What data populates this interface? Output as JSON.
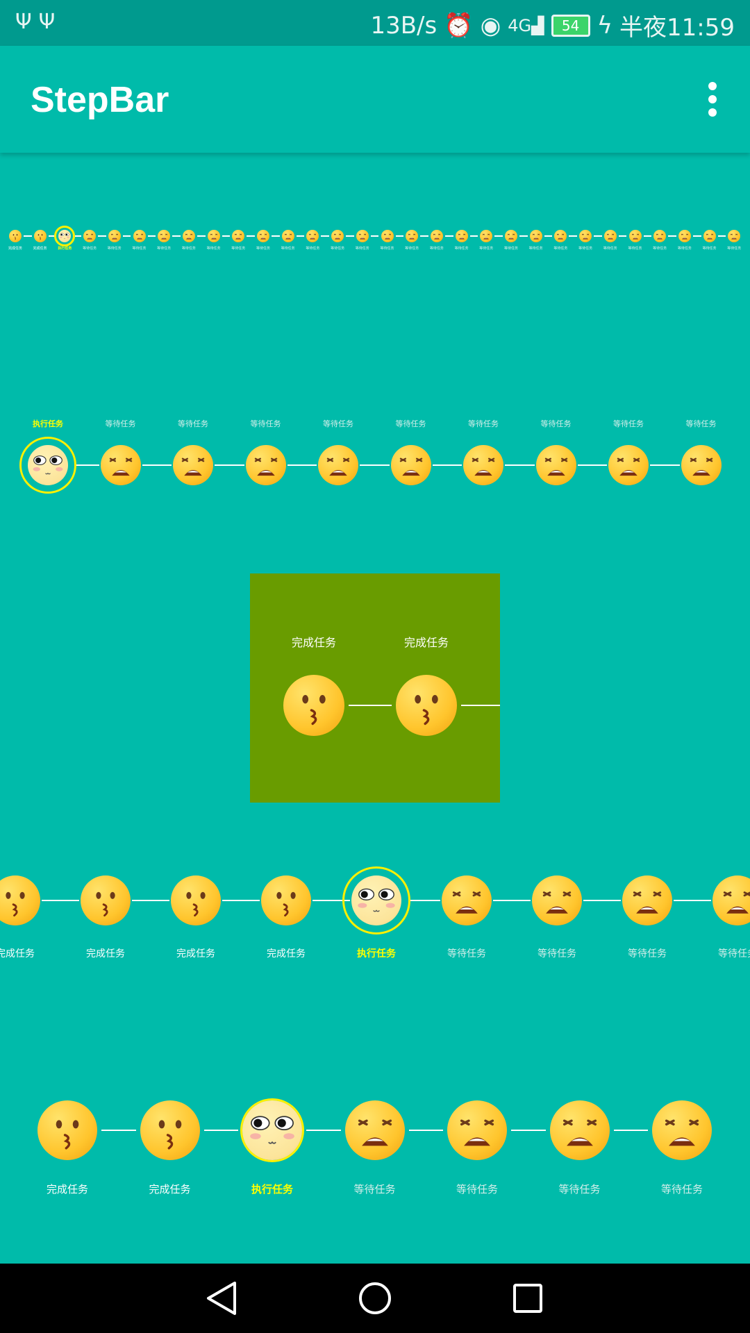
{
  "status_bar": {
    "left_icons": [
      "usb-icon",
      "usb-icon"
    ],
    "net_speed": "13B/s",
    "icons": [
      "alarm-icon",
      "eye-icon",
      "signal-4g-icon"
    ],
    "battery": "54",
    "time": "半夜11:59"
  },
  "app_bar": {
    "title": "StepBar",
    "menu_icon": "overflow-menu-icon"
  },
  "labels": {
    "done": "完成任务",
    "active": "执行任务",
    "waiting": "等待任务"
  },
  "steppers": [
    {
      "name": "stepper-1",
      "total": 30,
      "completed": 2,
      "active_index": 2
    },
    {
      "name": "stepper-2",
      "total": 10,
      "completed": 0,
      "active_index": 0
    },
    {
      "name": "stepper-3",
      "total": 2,
      "completed": 2,
      "active_index": null
    },
    {
      "name": "stepper-4",
      "total": 9,
      "completed": 4,
      "active_index": 4
    },
    {
      "name": "stepper-5",
      "total": 7,
      "completed": 2,
      "active_index": 2
    }
  ],
  "colors": {
    "background": "#00BBAA",
    "status_bar": "#009A8E",
    "panel": "#699C00",
    "active_ring": "#FFF000",
    "active_label": "#FFFF00"
  },
  "nav_bar": {
    "icons": [
      "back-icon",
      "home-icon",
      "recents-icon"
    ]
  }
}
